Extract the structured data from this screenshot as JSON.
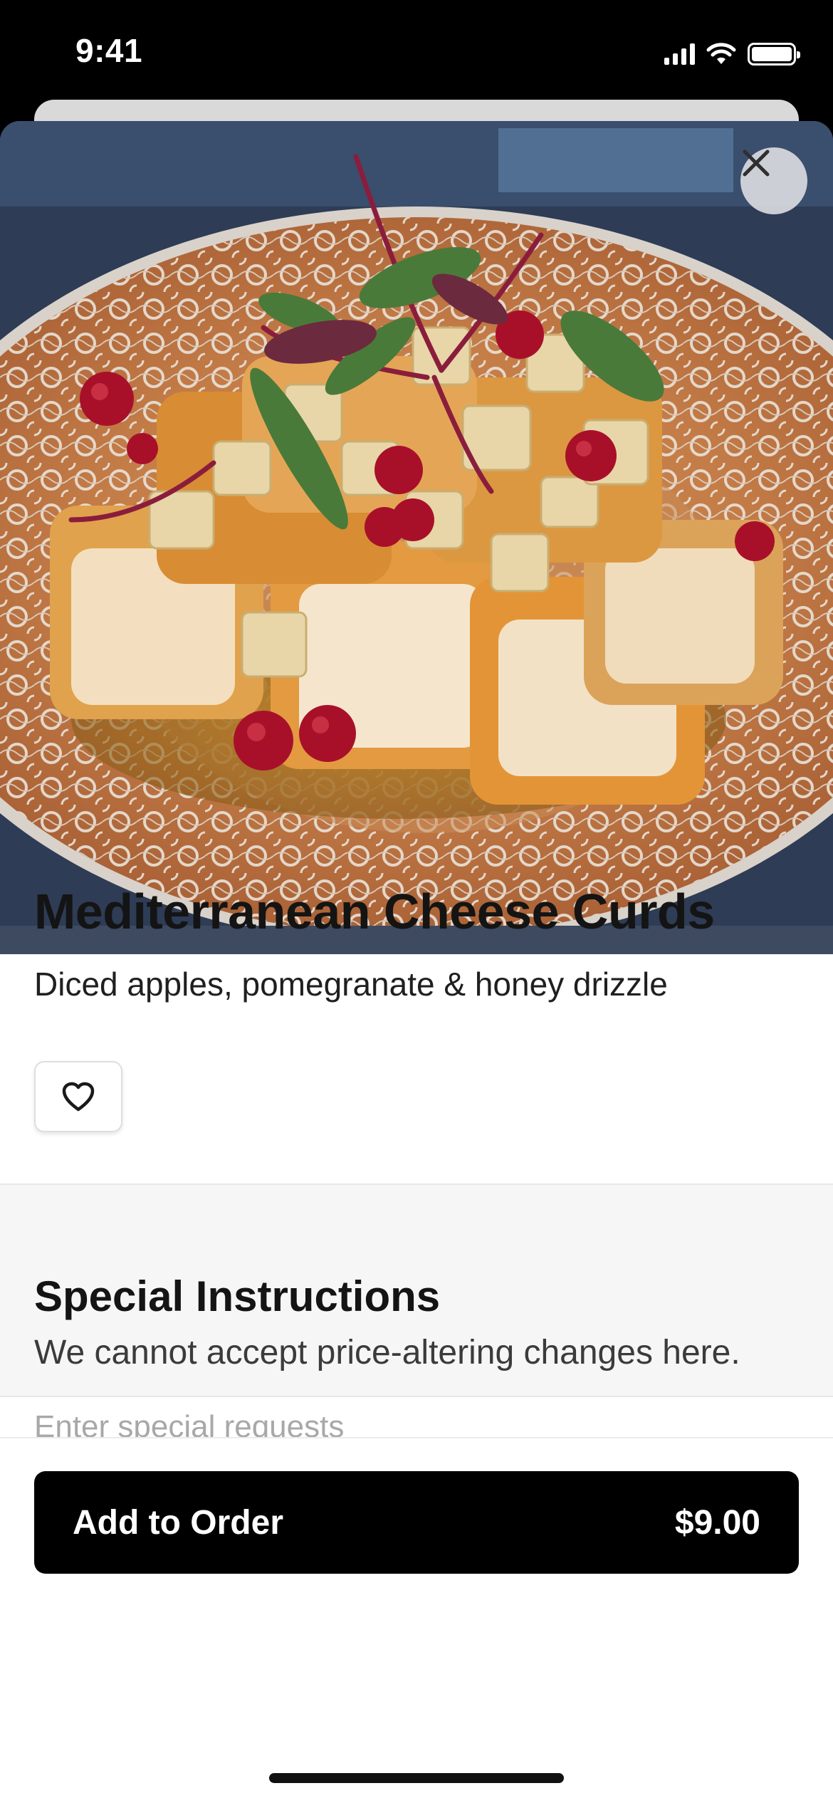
{
  "status_bar": {
    "time": "9:41"
  },
  "item": {
    "title": "Mediterranean Cheese Curds",
    "description": "Diced apples, pomegranate & honey drizzle"
  },
  "instructions": {
    "title": "Special Instructions",
    "note": "We cannot accept price-altering changes here.",
    "placeholder": "Enter special requests"
  },
  "order_button": {
    "label": "Add to Order",
    "price": "$9.00"
  },
  "colors": {
    "primary": "#000000",
    "background": "#ffffff",
    "section_bg": "#f6f6f6"
  }
}
